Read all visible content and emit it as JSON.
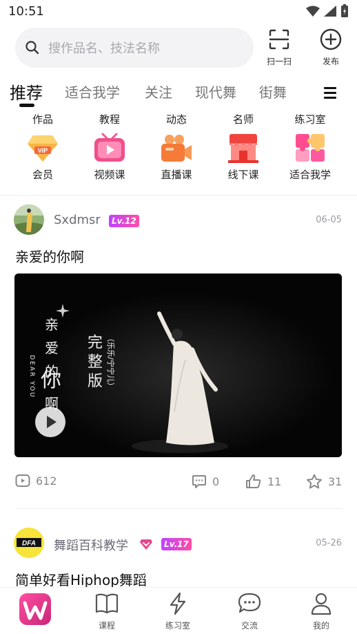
{
  "status_bar": {
    "time": "10:51"
  },
  "search": {
    "placeholder": "搜作品名、技法名称"
  },
  "top_actions": {
    "scan_label": "扫一扫",
    "publish_label": "发布"
  },
  "tabs": [
    {
      "label": "推荐",
      "active": true
    },
    {
      "label": "适合我学",
      "active": false
    },
    {
      "label": "关注",
      "active": false
    },
    {
      "label": "现代舞",
      "active": false
    },
    {
      "label": "街舞",
      "active": false
    }
  ],
  "subcategories": [
    "作品",
    "教程",
    "动态",
    "名师",
    "练习室"
  ],
  "features": [
    {
      "label": "会员",
      "icon": "vip-diamond-icon"
    },
    {
      "label": "视频课",
      "icon": "video-course-icon"
    },
    {
      "label": "直播课",
      "icon": "live-camera-icon"
    },
    {
      "label": "线下课",
      "icon": "storefront-icon"
    },
    {
      "label": "适合我学",
      "icon": "puzzle-icon"
    }
  ],
  "posts": [
    {
      "username": "Sxdmsr",
      "level": "Lv.12",
      "date": "06-05",
      "title": "亲爱的你啊",
      "video_overlay": {
        "vertical_title": [
          "亲",
          "爱",
          "的",
          "你",
          "啊"
        ],
        "english": "DEAR YOU",
        "version": [
          "完",
          "整",
          "版"
        ],
        "credit": "（乐乐/宁宁儿）"
      },
      "stats": {
        "views": "612",
        "comments": "0",
        "likes": "11",
        "favorites": "31"
      }
    },
    {
      "username": "舞蹈百科教学",
      "level": "Lv.17",
      "date": "05-26",
      "title": "简单好看Hiphop舞蹈",
      "avatar_text": "DFA"
    }
  ],
  "bottom_nav": [
    {
      "label": "",
      "icon": "app-logo-icon"
    },
    {
      "label": "课程",
      "icon": "book-icon"
    },
    {
      "label": "练习室",
      "icon": "lightning-icon"
    },
    {
      "label": "交流",
      "icon": "chat-icon"
    },
    {
      "label": "我的",
      "icon": "person-icon"
    }
  ],
  "colors": {
    "accent_pink": "#e8458b",
    "level_badge": "#c042ff",
    "muted_text": "#6b6b78"
  }
}
